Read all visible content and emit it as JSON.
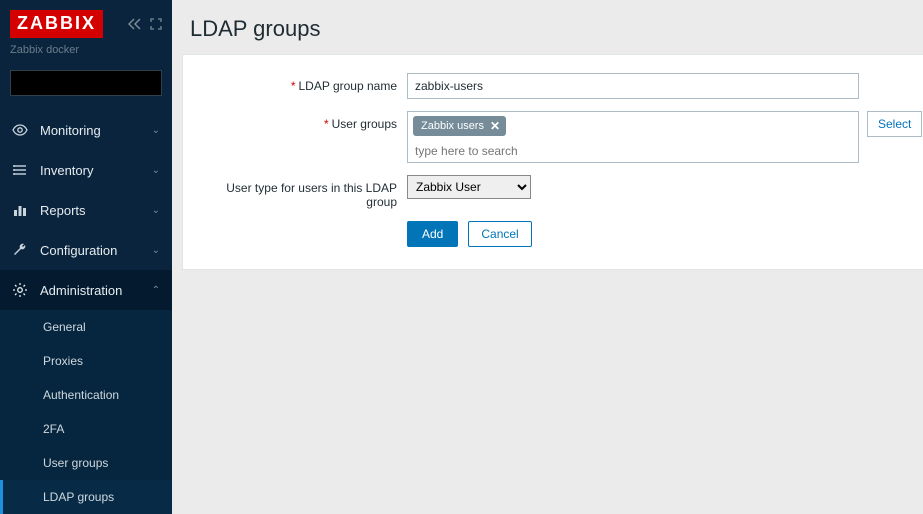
{
  "brand": {
    "logo": "ZABBIX",
    "subtitle": "Zabbix docker"
  },
  "search": {
    "placeholder": ""
  },
  "nav": {
    "monitoring": "Monitoring",
    "inventory": "Inventory",
    "reports": "Reports",
    "configuration": "Configuration",
    "administration": "Administration"
  },
  "subnav": {
    "general": "General",
    "proxies": "Proxies",
    "authentication": "Authentication",
    "twofa": "2FA",
    "user_groups": "User groups",
    "ldap_groups": "LDAP groups"
  },
  "page": {
    "title": "LDAP groups"
  },
  "form": {
    "labels": {
      "ldap_group_name": "LDAP group name",
      "user_groups": "User groups",
      "user_type": "User type for users in this LDAP group"
    },
    "ldap_group_name_value": "zabbix-users",
    "user_groups_tag": "Zabbix users",
    "user_groups_placeholder": "type here to search",
    "user_type_value": "Zabbix User",
    "select_button": "Select",
    "add_button": "Add",
    "cancel_button": "Cancel"
  }
}
